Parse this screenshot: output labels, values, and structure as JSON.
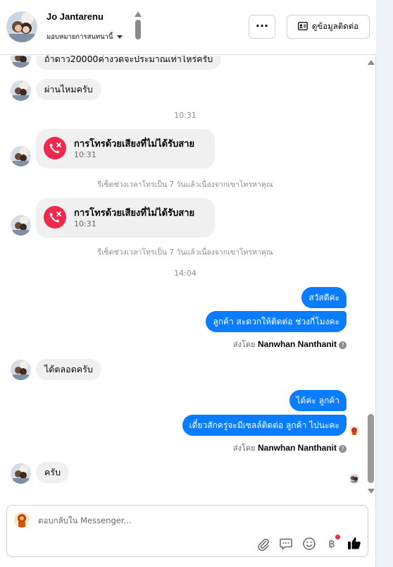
{
  "header": {
    "contact_name": "Jo Jantarenu",
    "subtitle": "มอบหมายการสนทนานี้",
    "more_label": "···",
    "info_label": "ดูข้อมูลติดต่อ"
  },
  "messages": {
    "partial_top": "ถ้าดาว20000ค่างวดจะประมาณเท่าไหร่ครับ",
    "in_1": "ผ่านไหมครับ",
    "time_1": "10:31",
    "call_1_title": "การโทรด้วยเสียงที่ไม่ได้รับสาย",
    "call_1_time": "10:31",
    "sys_1": "รีเซ็ตช่วงเวลาโทรเป็น 7 วันแล้วเนื่องจากเขาโทรหาคุณ",
    "call_2_title": "การโทรด้วยเสียงที่ไม่ได้รับสาย",
    "call_2_time": "10:31",
    "sys_2": "รีเซ็ตช่วงเวลาโทรเป็น 7 วันแล้วเนื่องจากเขาโทรหาคุณ",
    "time_2": "14:04",
    "out_1": "สวัสดีค่ะ",
    "out_2": "ลูกค้า สะดวกให้ติดต่อ ช่วงกี่โมงคะ",
    "sentby_prefix_1": "ส่งโดย",
    "sentby_name_1": "Nanwhan Nanthanit",
    "in_2": "ได้ตลอดครับ",
    "out_3": "ได้ค่ะ ลูกค้า",
    "out_4": "เดี๋ยวสักครู่จะมีเซลล์ติดต่อ ลูกค้า ไปนะคะ",
    "sentby_prefix_2": "ส่งโดย",
    "sentby_name_2": "Nanwhan Nanthanit",
    "in_3": "ครับ"
  },
  "composer": {
    "placeholder": "ตอบกลับใน Messenger..."
  },
  "icons": [
    "kebab-more-icon",
    "contact-card-icon",
    "missed-call-icon",
    "help-icon",
    "attach-icon",
    "saved-reply-icon",
    "emoji-icon",
    "baht-icon",
    "thumbs-up-icon"
  ],
  "colors": {
    "outgoing_bubble": "#0a7cff",
    "incoming_bubble": "#f0f0f0",
    "missed_call": "#f02849",
    "like": "#0a7cff"
  }
}
